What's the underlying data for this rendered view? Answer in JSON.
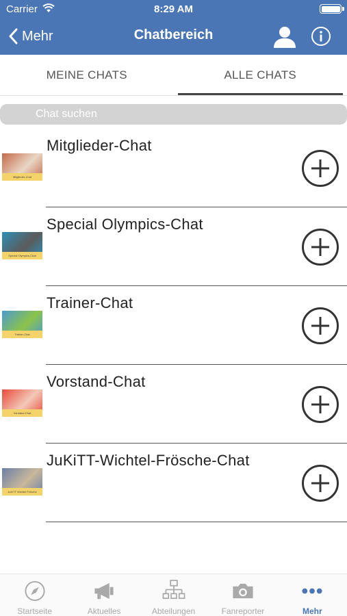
{
  "status_bar": {
    "carrier": "Carrier",
    "time": "8:29 AM"
  },
  "nav": {
    "back_label": "Mehr",
    "title": "Chatbereich"
  },
  "tabs": [
    {
      "label": "MEINE CHATS",
      "active": false
    },
    {
      "label": "ALLE CHATS",
      "active": true
    }
  ],
  "search": {
    "placeholder": "Chat suchen",
    "value": ""
  },
  "chats": [
    {
      "name": "Mitglieder-Chat",
      "thumb_caption": "Mitglieder-Chat",
      "thumb_colors": [
        "#c46a4a",
        "#e8d7c4"
      ]
    },
    {
      "name": "Special Olympics-Chat",
      "thumb_caption": "Special Olympics-Chat",
      "thumb_colors": [
        "#2e8fb8",
        "#5b5b5b"
      ]
    },
    {
      "name": "Trainer-Chat",
      "thumb_caption": "Trainer-Chat",
      "thumb_colors": [
        "#4b9bd0",
        "#8cc34a"
      ]
    },
    {
      "name": "Vorstand-Chat",
      "thumb_caption": "Vorstand-Chat",
      "thumb_colors": [
        "#e84a3a",
        "#f3c8b8"
      ]
    },
    {
      "name": "JuKiTT-Wichtel-Frösche-Chat",
      "thumb_caption": "JuKiTT Wichtel Frösche",
      "thumb_colors": [
        "#6b7fa6",
        "#c9b89a"
      ]
    }
  ],
  "tabbar": [
    {
      "label": "Startseite",
      "icon": "compass-icon",
      "active": false
    },
    {
      "label": "Aktuelles",
      "icon": "megaphone-icon",
      "active": false
    },
    {
      "label": "Abteilungen",
      "icon": "org-chart-icon",
      "active": false
    },
    {
      "label": "Fanreporter",
      "icon": "camera-icon",
      "active": false
    },
    {
      "label": "Mehr",
      "icon": "more-dots-icon",
      "active": true
    }
  ],
  "colors": {
    "nav_bar": "#4a76b5",
    "accent": "#4a76b5",
    "search_bg": "#d3d3d3",
    "inactive_tab_label": "#a9a9a9"
  }
}
